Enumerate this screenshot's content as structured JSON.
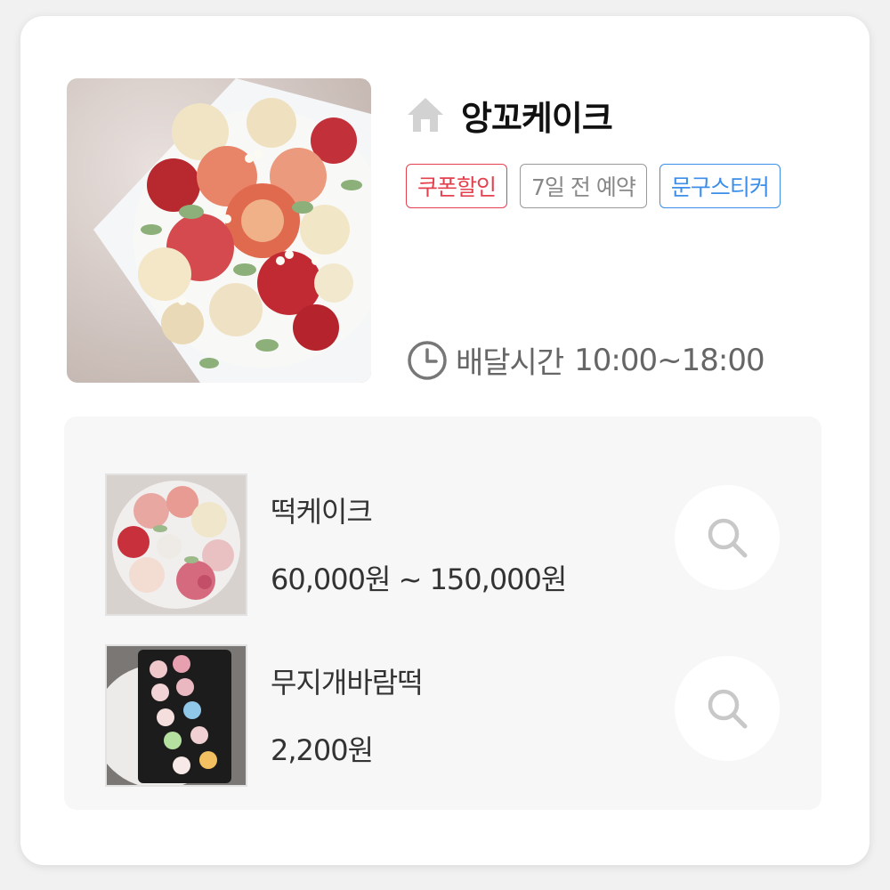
{
  "store": {
    "name": "앙꼬케이크",
    "icon": "home-icon",
    "photo": "flower-cake-photo"
  },
  "tags": [
    {
      "label": "쿠폰할인",
      "color": "#e4414f"
    },
    {
      "label": "7일 전 예약",
      "color": "#888888"
    },
    {
      "label": "문구스티커",
      "color": "#3c8ee8"
    }
  ],
  "delivery": {
    "icon": "clock-icon",
    "label": "배달시간",
    "hours": "10:00~18:00"
  },
  "products": [
    {
      "name": "떡케이크",
      "price": "60,000원 ~ 150,000원",
      "icon": "search-icon"
    },
    {
      "name": "무지개바람떡",
      "price": "2,200원",
      "icon": "search-icon"
    }
  ]
}
